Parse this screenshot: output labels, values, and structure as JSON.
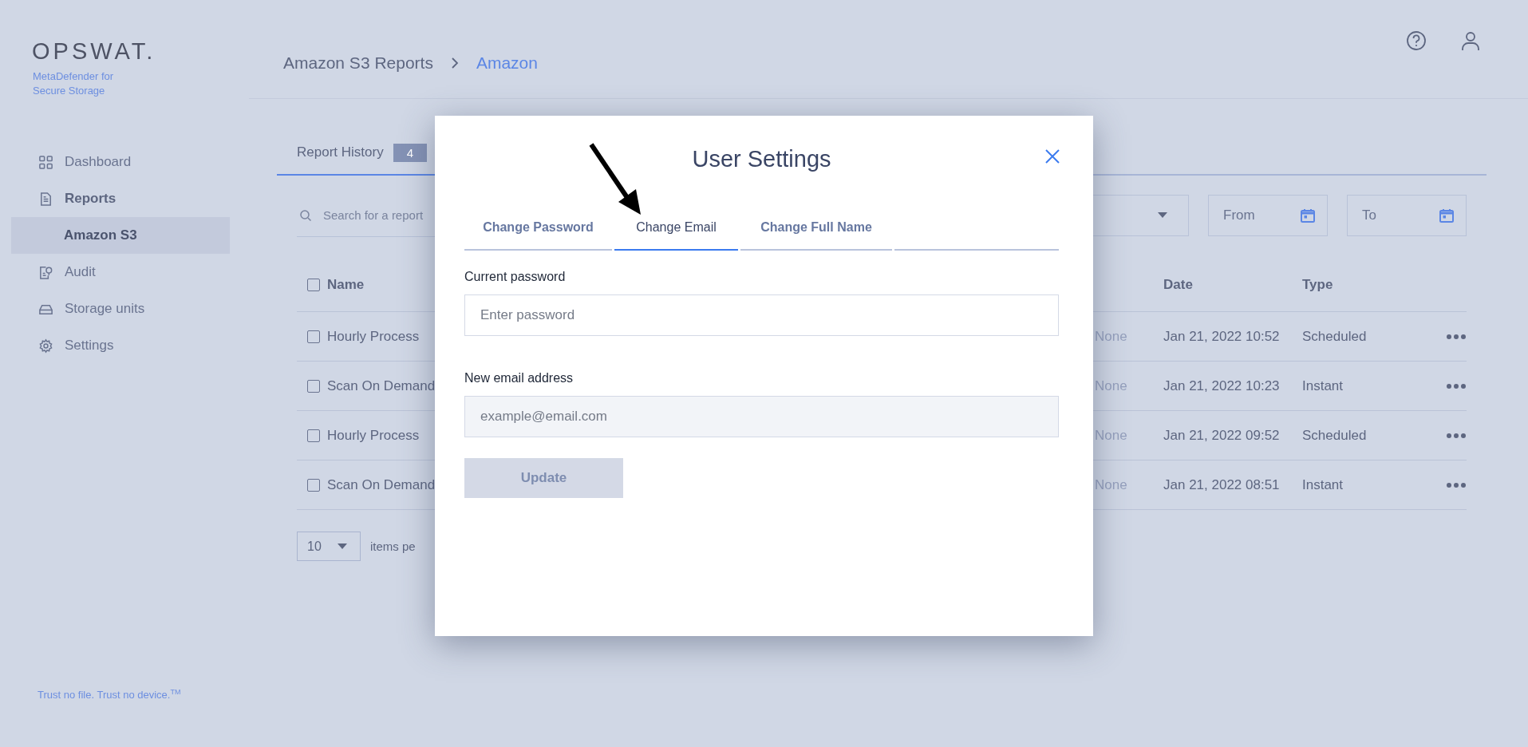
{
  "sidebar": {
    "logo": "OPSWAT.",
    "product": [
      "MetaDefender for",
      "Secure Storage"
    ],
    "items": [
      {
        "label": "Dashboard",
        "expanded": false,
        "selected": false
      },
      {
        "label": "Reports",
        "expanded": true,
        "selected": false,
        "children": [
          {
            "label": "Amazon S3",
            "selected": true
          }
        ]
      },
      {
        "label": "Audit",
        "expanded": false,
        "selected": false
      },
      {
        "label": "Storage units",
        "expanded": false,
        "selected": false
      },
      {
        "label": "Settings",
        "expanded": false,
        "selected": false
      }
    ],
    "footer": "Trust no file. Trust no device.$^{TM}$"
  },
  "breadcrumb": [
    "Amazon S3 Reports",
    "Amazon"
  ],
  "tabs": [
    {
      "label": "Report History",
      "badge": "4",
      "selected": true
    }
  ],
  "filters": {
    "search_placeholder": "Search for a report",
    "from_placeholder": "From",
    "to_placeholder": "To"
  },
  "table": {
    "header": {
      "name": "Name",
      "date": "Date",
      "type": "Type",
      "checked": false
    },
    "rows": [
      {
        "name": "Hourly Process",
        "column_2": "None",
        "date": "Jan 21, 2022 10:52",
        "type": "Scheduled",
        "checked": false
      },
      {
        "name": "Scan On Demand",
        "column_2": "None",
        "date": "Jan 21, 2022 10:23",
        "type": "Instant",
        "checked": false
      },
      {
        "name": "Hourly Process",
        "column_2": "None",
        "date": "Jan 21, 2022 09:52",
        "type": "Scheduled",
        "checked": false
      },
      {
        "name": "Scan On Demand",
        "column_2": "None",
        "date": "Jan 21, 2022 08:51",
        "type": "Instant",
        "checked": false
      }
    ]
  },
  "pagination": {
    "page_size": "10",
    "label": "items pe"
  },
  "dialog": {
    "title": "User Settings",
    "tabs": [
      {
        "label": "Change Password",
        "selected": false
      },
      {
        "label": "Change Email",
        "selected": true
      },
      {
        "label": "Change Full Name",
        "selected": false
      }
    ],
    "fields": [
      {
        "label": "Current password",
        "placeholder": "Enter password",
        "disabled": false
      },
      {
        "label": "New email address",
        "placeholder": "example@email.com",
        "disabled": true
      }
    ],
    "button": {
      "label": "Update",
      "disabled": true
    }
  }
}
